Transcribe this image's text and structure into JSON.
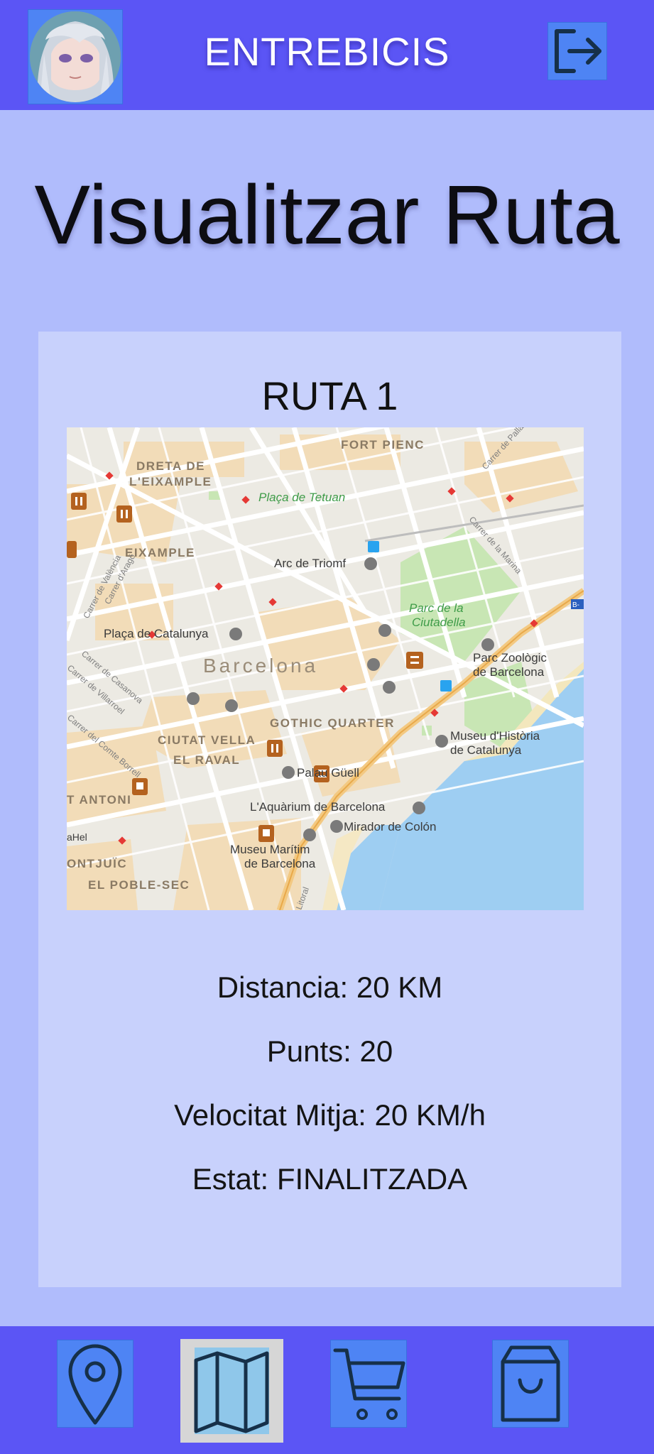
{
  "header": {
    "app_title": "ENTREBICIS",
    "avatar_icon": "user-avatar-icon",
    "logout_icon": "logout-icon"
  },
  "page": {
    "title": "Visualitzar Ruta"
  },
  "route": {
    "name": "RUTA 1",
    "stats": {
      "distance": "Distancia:  20 KM",
      "points": "Punts: 20",
      "avg_speed": "Velocitat Mitja: 20 KM/h",
      "status": "Estat: FINALITZADA"
    },
    "map": {
      "labels": {
        "fort_pienc": "FORT PIENC",
        "dreta1": "DRETA DE",
        "dreta2": "L'EIXAMPLE",
        "tetuan": "Plaça de Tetuan",
        "eixample": "EIXAMPLE",
        "arc": "Arc de Triomf",
        "valencia": "Carrer de València",
        "arago": "Carrer d'Aragó",
        "pallars": "Carrer de Pallars",
        "marina": "Carrer de la Marina",
        "parc1": "Parc de la",
        "parc2": "Ciutadella",
        "catalunya": "Plaça de Catalunya",
        "barcelona": "Barcelona",
        "zoo1": "Parc Zoològic",
        "zoo2": "de Barcelona",
        "casanova": "Carrer de Casanova",
        "villarroel": "Carrer de Villarroel",
        "borrell": "Carrer del Comte Borrell",
        "gothic": "GOTHIC QUARTER",
        "ciutat": "CIUTAT VELLA",
        "museu_hist1": "Museu d'Història",
        "museu_hist2": "de Catalunya",
        "raval": "EL RAVAL",
        "guell": "Palau Güell",
        "antoni": "T ANTONI",
        "aquarium": "L'Aquàrium de Barcelona",
        "colon": "Mirador de Colón",
        "hel": "aHel",
        "maritim1": "Museu Marítim",
        "maritim2": "de Barcelona",
        "montjuic": "ONTJUÏC",
        "poble_sec": "EL POBLE-SEC",
        "litoral": "Litoral",
        "b_badge": "B-"
      }
    }
  },
  "nav": {
    "items": [
      {
        "icon": "location-pin-icon"
      },
      {
        "icon": "map-icon"
      },
      {
        "icon": "shopping-cart-icon"
      },
      {
        "icon": "shopping-bag-icon"
      }
    ]
  },
  "colors": {
    "bar": "#5b55f5",
    "background": "#b0bcfc",
    "card": "#c8d1fc",
    "button": "#4e84f4"
  }
}
